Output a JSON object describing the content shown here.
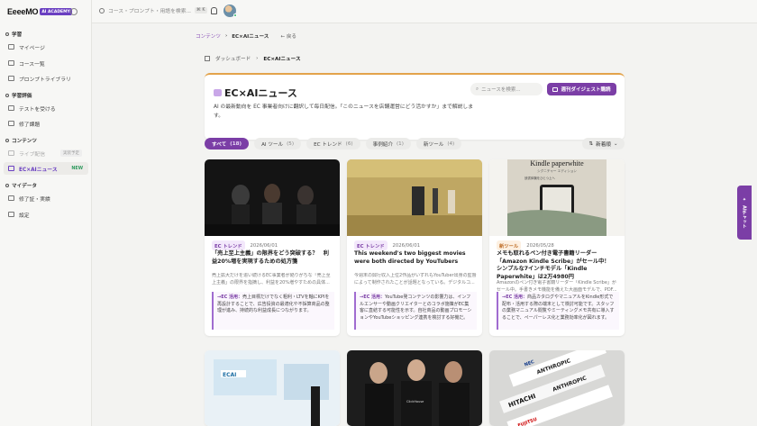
{
  "sidebar": {
    "logo_text": "EeeeMO",
    "logo_badge": "AI ACADEMY",
    "sections": [
      {
        "label": "学習",
        "items": [
          {
            "label": "マイページ"
          },
          {
            "label": "コース一覧"
          },
          {
            "label": "プロンプトライブラリ"
          }
        ]
      },
      {
        "label": "学習評価",
        "items": [
          {
            "label": "テストを受ける"
          },
          {
            "label": "修了課題"
          }
        ]
      },
      {
        "label": "コンテンツ",
        "items": [
          {
            "label": "ライブ配信",
            "tag": "実装予定"
          },
          {
            "label": "EC×AIニュース",
            "tag": "NEW"
          }
        ]
      },
      {
        "label": "マイデータ",
        "items": [
          {
            "label": "修了証・実績"
          },
          {
            "label": "設定"
          }
        ]
      }
    ]
  },
  "topbar": {
    "search_placeholder": "コース・プロンプト・用語を検索...",
    "shortcut": "⌘ K"
  },
  "breadcrumb_top": {
    "link": "コンテンツ",
    "current": "EC×AIニュース",
    "back": "戻る"
  },
  "breadcrumb_page": {
    "link": "ダッシュボード",
    "current": "EC×AIニュース"
  },
  "header": {
    "title": "EC×AIニュース",
    "description": "AI の最新動向を EC 事業者向けに翻訳して毎日配信。「このニュースを店舗運営にどう活かすか」まで解説します。",
    "search_placeholder": "ニュースを検索...",
    "digest_button": "週刊ダイジェスト購読"
  },
  "filters": [
    {
      "label": "すべて",
      "count": "(18)"
    },
    {
      "label": "AI ツール",
      "count": "(5)"
    },
    {
      "label": "EC トレンド",
      "count": "(6)"
    },
    {
      "label": "事例紹介",
      "count": "(1)"
    },
    {
      "label": "新ツール",
      "count": "(4)"
    }
  ],
  "sort_label": "新着順",
  "cards": [
    {
      "category": "EC トレンド",
      "date": "2026/06/01",
      "title": "「売上至上主義」の限界をどう突破する？　利益20%増を実現するための処方箋",
      "summary": "売上拡大だけを追い続けるEC事業者が陥りがちな「売上至上主義」の限界を指摘し、利益を20%増やすための具体...",
      "usecase_label": "→EC 活用：",
      "usecase": "売上目標だけでなく粗利・LTVを軸にKPIを再設計することで、広告投資の最適化や不採算商品の整理が進み、持続的な利益成長につながります。"
    },
    {
      "category": "EC トレンド",
      "date": "2026/06/01",
      "title": "This weekend's two biggest movies were both directed by YouTubers",
      "summary": "今週末の興行収入上位2作品がいずれもYouTuber出身の監督によって制作されたことが話題となっている。デジタルコ...",
      "usecase_label": "→EC 活用：",
      "usecase": "YouTube発コンテンツの影響力は、インフルエンサーや動画クリエイターとのコラボ施策がEC集客に直結する可能性を示す。自社商品の動画プロモーションやYouTubeショッピング連携を検討する好機だ。"
    },
    {
      "category": "新ツール",
      "date": "2026/05/28",
      "title": "メモも取れるペン付き電子書籍リーダー「Amazon Kindle Scribe」がセール中！　シンプルな7インチモデル「Kindle Paperwhite」は2万4980円",
      "summary": "Amazonのペン付き電子書籍リーダー「Kindle Scribe」がセール中。手書きメモ機能を備えた大画面モデルで、PDF...",
      "usecase_label": "→EC 活用：",
      "usecase": "商品カタログやマニュアルをKindle形式で配布・活用する際の端末として検討可能です。スタッフの業務マニュアル閲覧やミーティングメモ共有に導入することで、ペーパーレス化と業務効率化が図れます。"
    }
  ],
  "bottom_thumbs": [
    {
      "text": "ECAI"
    },
    {
      "text": "ClickHouse"
    },
    {
      "text": "ANTHROPIC"
    }
  ],
  "kindle_thumb": {
    "title": "Kindle paperwhite",
    "subtitle": "シグニチャー エディション",
    "tagline": "読書体験をひとつ上へ"
  },
  "bottom3_labels": [
    "HITACHI",
    "ANTHROPIC",
    "NEC",
    "FUJITSU"
  ],
  "ai_tab_label": "AIチャット"
}
